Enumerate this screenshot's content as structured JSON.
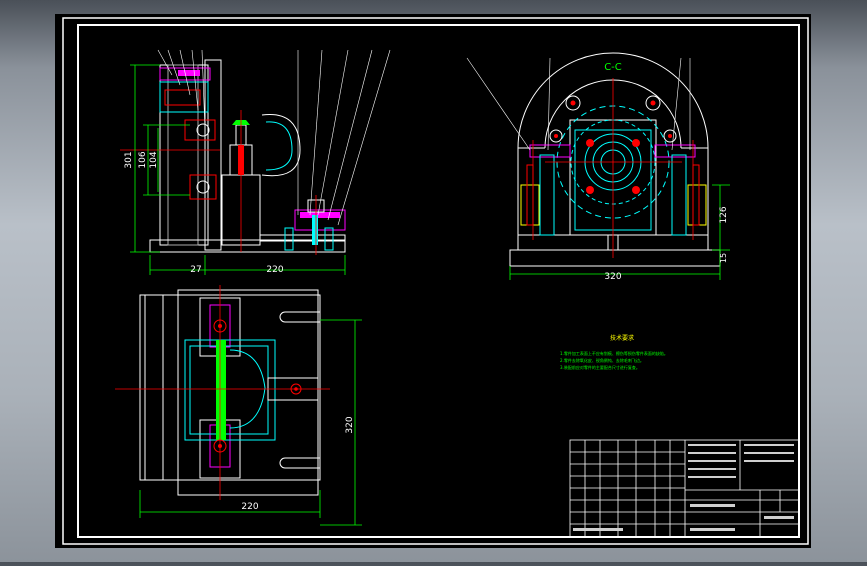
{
  "drawing": {
    "section_label": "C-C",
    "tech_req_title": "技术要求",
    "tech_req_lines": [
      "1.零件加工表面上不应有划痕、擦伤等损伤零件表面的缺陷。",
      "2.零件去除氧化皮、锐角倒钝、去除毛刺飞边。",
      "3.装配前应对零件的主要配合尺寸进行复查。"
    ]
  },
  "dimensions": {
    "side_height_outer": "301",
    "side_height_mid": "106",
    "side_height_inner": "104",
    "side_offset": "27",
    "side_width": "220",
    "section_width": "320",
    "section_height": "126",
    "section_base": "15",
    "plan_width": "220",
    "plan_height": "320"
  },
  "colors": {
    "background": "#000000",
    "frame": "#ffffff",
    "outline": "#ffffff",
    "dimension": "#00ff00",
    "centerline": "#ff0000",
    "hidden": "#00ffff",
    "accent_yellow": "#ffff00",
    "callout": "#ffffff"
  },
  "icons": [
    "screw-icon",
    "bolt-icon",
    "hole-icon"
  ]
}
